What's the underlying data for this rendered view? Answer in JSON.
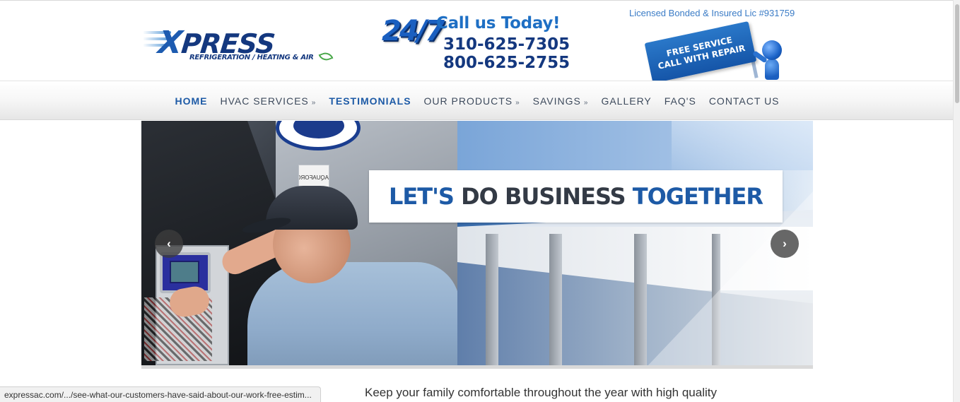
{
  "header": {
    "logo": {
      "word_x": "X",
      "word_rest": "PRESS",
      "tagline": "REFRIGERATION / HEATING & AIR"
    },
    "badge_247": "24/7",
    "call_title": "Call us Today!",
    "phone_1": "310-625-7305",
    "phone_2": "800-625-2755",
    "licensed": "Licensed Bonded & Insured Lic #931759",
    "sign_line_1": "FREE SERVICE",
    "sign_line_2": "CALL WITH REPAIR"
  },
  "nav": {
    "items": [
      {
        "label": "HOME",
        "dropdown": false
      },
      {
        "label": "HVAC SERVICES",
        "dropdown": true
      },
      {
        "label": "TESTIMONIALS",
        "dropdown": false
      },
      {
        "label": "OUR PRODUCTS",
        "dropdown": true
      },
      {
        "label": "SAVINGS",
        "dropdown": true
      },
      {
        "label": "GALLERY",
        "dropdown": false
      },
      {
        "label": "FAQ'S",
        "dropdown": false
      },
      {
        "label": "CONTACT US",
        "dropdown": false
      }
    ],
    "chevron": "»"
  },
  "slider": {
    "headline_part_1": "LET'S",
    "headline_part_2": "DO BUSINESS",
    "headline_part_3": "TOGETHER",
    "prev_icon": "‹",
    "next_icon": "›",
    "aqua_label": "AQUAFORCE"
  },
  "content": {
    "intro_text": "Keep your family comfortable throughout the year with high quality"
  },
  "status_bar": {
    "url": "expressac.com/.../see-what-our-customers-have-said-about-our-work-free-estim..."
  },
  "colors": {
    "brand_blue": "#1d5aa6",
    "brand_navy": "#14387f",
    "accent_blue": "#1e6fc4"
  }
}
